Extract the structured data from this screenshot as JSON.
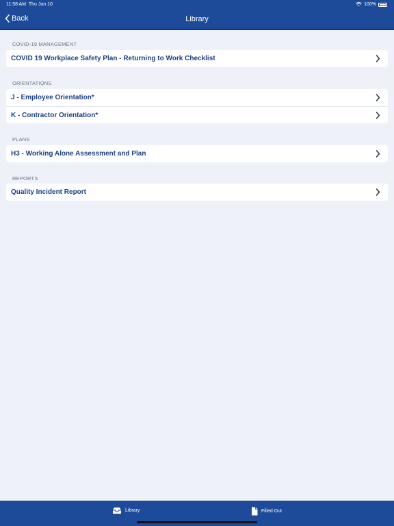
{
  "status": {
    "time": "11:58 AM",
    "date": "Thu Jun 10",
    "battery": "100%"
  },
  "nav": {
    "back_label": "Back",
    "title": "Library"
  },
  "sections": [
    {
      "header": "COVID-19 MANAGEMENT",
      "items": [
        "COVID 19 Workplace Safety Plan - Returning to Work Checklist"
      ]
    },
    {
      "header": "ORIENTATIONS",
      "items": [
        "J - Employee Orientation*",
        "K - Contractor Orientation*"
      ]
    },
    {
      "header": "PLANS",
      "items": [
        "H3 - Working Alone Assessment and Plan"
      ]
    },
    {
      "header": "REPORTS",
      "items": [
        "Quality Incident Report"
      ]
    }
  ],
  "tabs": [
    {
      "label": "Library",
      "icon": "tray-icon"
    },
    {
      "label": "Filled Out",
      "icon": "document-icon"
    }
  ],
  "colors": {
    "accent": "#1d4b9a",
    "text_link": "#1d3f82",
    "background": "#eef2f8"
  }
}
